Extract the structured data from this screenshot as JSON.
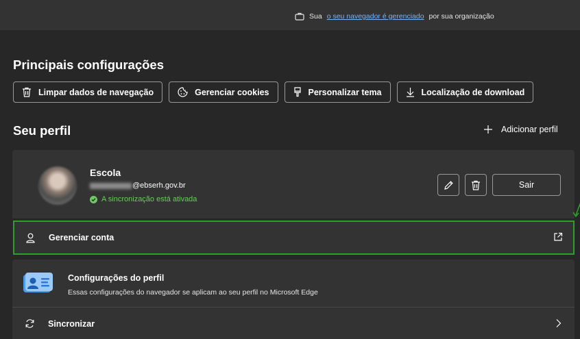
{
  "banner": {
    "prefix": "Sua",
    "link": "o seu navegador é gerenciado",
    "suffix": "por sua organização"
  },
  "main_settings": {
    "title": "Principais configurações",
    "buttons": [
      {
        "label": "Limpar dados de navegação",
        "icon": "trash-icon"
      },
      {
        "label": "Gerenciar cookies",
        "icon": "cookie-icon"
      },
      {
        "label": "Personalizar tema",
        "icon": "brush-icon"
      },
      {
        "label": "Localização de download",
        "icon": "download-icon"
      }
    ]
  },
  "profile": {
    "title": "Seu perfil",
    "add_label": "Adicionar perfil",
    "name": "Escola",
    "email_domain": "@ebserh.gov.br",
    "sync_status": "A sincronização está ativada",
    "signout_label": "Sair",
    "manage_label": "Gerenciar conta",
    "settings_title": "Configurações do perfil",
    "settings_desc": "Essas configurações do navegador se aplicam ao seu perfil no Microsoft Edge",
    "sync_label": "Sincronizar"
  },
  "colors": {
    "background": "#272727",
    "card": "#333333",
    "accent_green": "#2f9e2f",
    "sync_green": "#6ccb5f",
    "link_blue": "#7ab4f5"
  }
}
